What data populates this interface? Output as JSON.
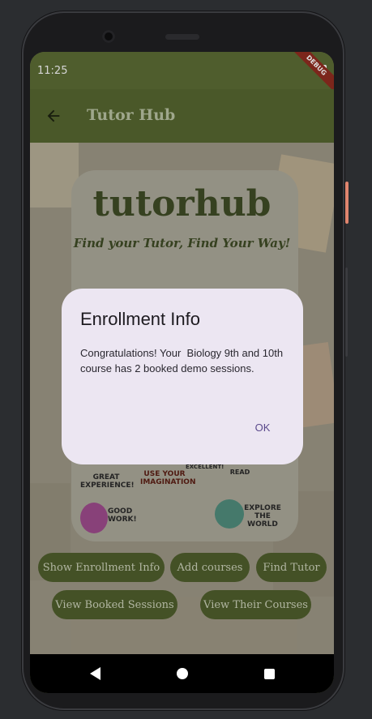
{
  "status_bar": {
    "time": "11:25",
    "debug_banner": "DEBUG"
  },
  "app_bar": {
    "title": "Tutor Hub"
  },
  "hero": {
    "brand": "tutorhub",
    "tagline": "Find your Tutor, Find Your Way!"
  },
  "stickers": {
    "great_experience": "GREAT EXPERIENCE!",
    "excellent": "EXCELLENT!",
    "read": "READ",
    "good_work": "GOOD WORK!",
    "use_your_imagination": "USE YOUR IMAGINATION",
    "explore_the_world": "EXPLORE THE WORLD"
  },
  "buttons": {
    "show_enrollment_info": "Show Enrollment Info",
    "add_courses": "Add courses",
    "find_tutor": "Find Tutor",
    "view_booked_sessions": "View Booked Sessions",
    "view_their_courses": "View Their Courses"
  },
  "dialog": {
    "title": "Enrollment Info",
    "body": "Congratulations! Your  Biology 9th and 10th course has 2 booked demo sessions.",
    "ok_label": "OK"
  },
  "colors": {
    "app_bar": "#55652f",
    "button": "#4e5d2c",
    "dialog_bg": "#ece6f2",
    "dialog_action": "#5b4a8c"
  }
}
